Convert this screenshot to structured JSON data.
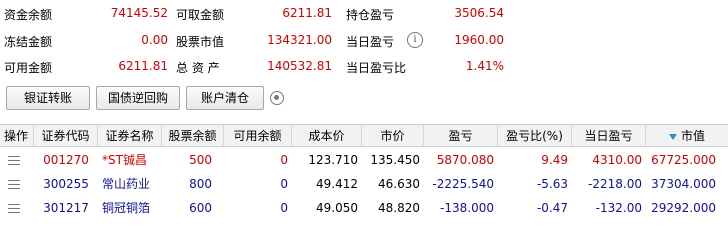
{
  "summary": {
    "zijin_yue_label": "资金余额",
    "zijin_yue_value": "74145.52",
    "kequ_jine_label": "可取金额",
    "kequ_jine_value": "6211.81",
    "chicang_yingkui_label": "持仓盈亏",
    "chicang_yingkui_value": "3506.54",
    "dongjie_jine_label": "冻结金额",
    "dongjie_jine_value": "0.00",
    "gupiao_shizhi_label": "股票市值",
    "gupiao_shizhi_value": "134321.00",
    "dangri_yingkui_label": "当日盈亏",
    "dangri_yingkui_value": "1960.00",
    "keyong_jine_label": "可用金额",
    "keyong_jine_value": "6211.81",
    "zongzichan_label": "总 资 产",
    "zongzichan_value": "140532.81",
    "dangri_yingkuibi_label": "当日盈亏比",
    "dangri_yingkuibi_value": "1.41%"
  },
  "toolbar": {
    "bank_transfer": "银证转账",
    "reverse_repo": "国债逆回购",
    "clear_account": "账户清仓"
  },
  "table": {
    "headers": [
      "操作",
      "证券代码",
      "证券名称",
      "股票余额",
      "可用余额",
      "成本价",
      "市价",
      "盈亏",
      "盈亏比(%)",
      "当日盈亏",
      "市值"
    ],
    "rows": [
      {
        "code": "001270",
        "name": "*ST铖昌",
        "balance": "500",
        "available": "0",
        "cost": "123.710",
        "price": "135.450",
        "pnl": "5870.080",
        "pnl_ratio": "9.49",
        "day_pnl": "4310.00",
        "market_value": "67725.000"
      },
      {
        "code": "300255",
        "name": "常山药业",
        "balance": "800",
        "available": "0",
        "cost": "49.412",
        "price": "46.630",
        "pnl": "-2225.540",
        "pnl_ratio": "-5.63",
        "day_pnl": "-2218.00",
        "market_value": "37304.000"
      },
      {
        "code": "301217",
        "name": "铜冠铜箔",
        "balance": "600",
        "available": "0",
        "cost": "49.050",
        "price": "48.820",
        "pnl": "-138.000",
        "pnl_ratio": "-0.47",
        "day_pnl": "-132.00",
        "market_value": "29292.000"
      }
    ]
  },
  "colors": {
    "positive": "#d40000",
    "negative": "#1010a0",
    "header_bg": "#f2f2f2"
  },
  "icons": {
    "info": "info-icon",
    "settings": "gear-icon",
    "row_menu": "menu-icon",
    "sort": "sort-desc-icon"
  }
}
